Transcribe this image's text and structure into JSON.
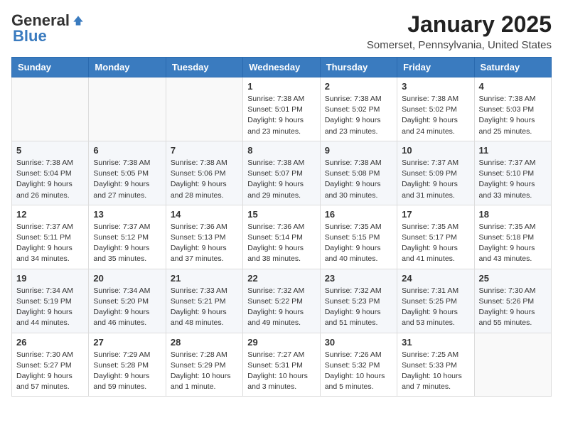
{
  "header": {
    "logo_general": "General",
    "logo_blue": "Blue",
    "month_title": "January 2025",
    "location": "Somerset, Pennsylvania, United States"
  },
  "weekdays": [
    "Sunday",
    "Monday",
    "Tuesday",
    "Wednesday",
    "Thursday",
    "Friday",
    "Saturday"
  ],
  "weeks": [
    [
      {
        "day": "",
        "info": ""
      },
      {
        "day": "",
        "info": ""
      },
      {
        "day": "",
        "info": ""
      },
      {
        "day": "1",
        "info": "Sunrise: 7:38 AM\nSunset: 5:01 PM\nDaylight: 9 hours\nand 23 minutes."
      },
      {
        "day": "2",
        "info": "Sunrise: 7:38 AM\nSunset: 5:02 PM\nDaylight: 9 hours\nand 23 minutes."
      },
      {
        "day": "3",
        "info": "Sunrise: 7:38 AM\nSunset: 5:02 PM\nDaylight: 9 hours\nand 24 minutes."
      },
      {
        "day": "4",
        "info": "Sunrise: 7:38 AM\nSunset: 5:03 PM\nDaylight: 9 hours\nand 25 minutes."
      }
    ],
    [
      {
        "day": "5",
        "info": "Sunrise: 7:38 AM\nSunset: 5:04 PM\nDaylight: 9 hours\nand 26 minutes."
      },
      {
        "day": "6",
        "info": "Sunrise: 7:38 AM\nSunset: 5:05 PM\nDaylight: 9 hours\nand 27 minutes."
      },
      {
        "day": "7",
        "info": "Sunrise: 7:38 AM\nSunset: 5:06 PM\nDaylight: 9 hours\nand 28 minutes."
      },
      {
        "day": "8",
        "info": "Sunrise: 7:38 AM\nSunset: 5:07 PM\nDaylight: 9 hours\nand 29 minutes."
      },
      {
        "day": "9",
        "info": "Sunrise: 7:38 AM\nSunset: 5:08 PM\nDaylight: 9 hours\nand 30 minutes."
      },
      {
        "day": "10",
        "info": "Sunrise: 7:37 AM\nSunset: 5:09 PM\nDaylight: 9 hours\nand 31 minutes."
      },
      {
        "day": "11",
        "info": "Sunrise: 7:37 AM\nSunset: 5:10 PM\nDaylight: 9 hours\nand 33 minutes."
      }
    ],
    [
      {
        "day": "12",
        "info": "Sunrise: 7:37 AM\nSunset: 5:11 PM\nDaylight: 9 hours\nand 34 minutes."
      },
      {
        "day": "13",
        "info": "Sunrise: 7:37 AM\nSunset: 5:12 PM\nDaylight: 9 hours\nand 35 minutes."
      },
      {
        "day": "14",
        "info": "Sunrise: 7:36 AM\nSunset: 5:13 PM\nDaylight: 9 hours\nand 37 minutes."
      },
      {
        "day": "15",
        "info": "Sunrise: 7:36 AM\nSunset: 5:14 PM\nDaylight: 9 hours\nand 38 minutes."
      },
      {
        "day": "16",
        "info": "Sunrise: 7:35 AM\nSunset: 5:15 PM\nDaylight: 9 hours\nand 40 minutes."
      },
      {
        "day": "17",
        "info": "Sunrise: 7:35 AM\nSunset: 5:17 PM\nDaylight: 9 hours\nand 41 minutes."
      },
      {
        "day": "18",
        "info": "Sunrise: 7:35 AM\nSunset: 5:18 PM\nDaylight: 9 hours\nand 43 minutes."
      }
    ],
    [
      {
        "day": "19",
        "info": "Sunrise: 7:34 AM\nSunset: 5:19 PM\nDaylight: 9 hours\nand 44 minutes."
      },
      {
        "day": "20",
        "info": "Sunrise: 7:34 AM\nSunset: 5:20 PM\nDaylight: 9 hours\nand 46 minutes."
      },
      {
        "day": "21",
        "info": "Sunrise: 7:33 AM\nSunset: 5:21 PM\nDaylight: 9 hours\nand 48 minutes."
      },
      {
        "day": "22",
        "info": "Sunrise: 7:32 AM\nSunset: 5:22 PM\nDaylight: 9 hours\nand 49 minutes."
      },
      {
        "day": "23",
        "info": "Sunrise: 7:32 AM\nSunset: 5:23 PM\nDaylight: 9 hours\nand 51 minutes."
      },
      {
        "day": "24",
        "info": "Sunrise: 7:31 AM\nSunset: 5:25 PM\nDaylight: 9 hours\nand 53 minutes."
      },
      {
        "day": "25",
        "info": "Sunrise: 7:30 AM\nSunset: 5:26 PM\nDaylight: 9 hours\nand 55 minutes."
      }
    ],
    [
      {
        "day": "26",
        "info": "Sunrise: 7:30 AM\nSunset: 5:27 PM\nDaylight: 9 hours\nand 57 minutes."
      },
      {
        "day": "27",
        "info": "Sunrise: 7:29 AM\nSunset: 5:28 PM\nDaylight: 9 hours\nand 59 minutes."
      },
      {
        "day": "28",
        "info": "Sunrise: 7:28 AM\nSunset: 5:29 PM\nDaylight: 10 hours\nand 1 minute."
      },
      {
        "day": "29",
        "info": "Sunrise: 7:27 AM\nSunset: 5:31 PM\nDaylight: 10 hours\nand 3 minutes."
      },
      {
        "day": "30",
        "info": "Sunrise: 7:26 AM\nSunset: 5:32 PM\nDaylight: 10 hours\nand 5 minutes."
      },
      {
        "day": "31",
        "info": "Sunrise: 7:25 AM\nSunset: 5:33 PM\nDaylight: 10 hours\nand 7 minutes."
      },
      {
        "day": "",
        "info": ""
      }
    ]
  ]
}
